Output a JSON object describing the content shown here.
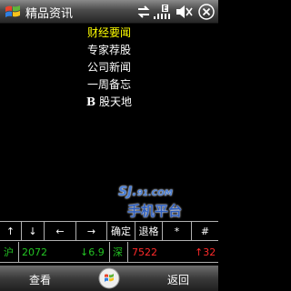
{
  "titlebar": {
    "title": "精品资讯",
    "icons": [
      "windows-start-icon",
      "connectivity-icon",
      "signal-e-icon",
      "volume-muted-icon",
      "close-icon"
    ]
  },
  "menu": {
    "items": [
      {
        "label": "财经要闻",
        "selected": true
      },
      {
        "label": "专家荐股",
        "selected": false
      },
      {
        "label": "公司新闻",
        "selected": false
      },
      {
        "label": "一周备忘",
        "selected": false
      },
      {
        "label_bold": "B",
        "label": " 股天地",
        "selected": false
      }
    ]
  },
  "watermark": {
    "top_main": "SJ.",
    "top_sub": "91.COM",
    "bottom": "手机平台"
  },
  "buttons": [
    "↑",
    "↓",
    "←",
    "→",
    "确定",
    "退格",
    "*",
    "#"
  ],
  "quotes": {
    "sh_label": "沪",
    "sh_value": "2072",
    "sh_change": "↓6.9",
    "sz_label": "深",
    "sz_value": "7522",
    "sz_change": "↑32"
  },
  "softkeys": {
    "left": "查看",
    "right": "返回"
  },
  "colors": {
    "selected": "#ffff00",
    "down": "#23c423",
    "up": "#ff2a2a"
  }
}
